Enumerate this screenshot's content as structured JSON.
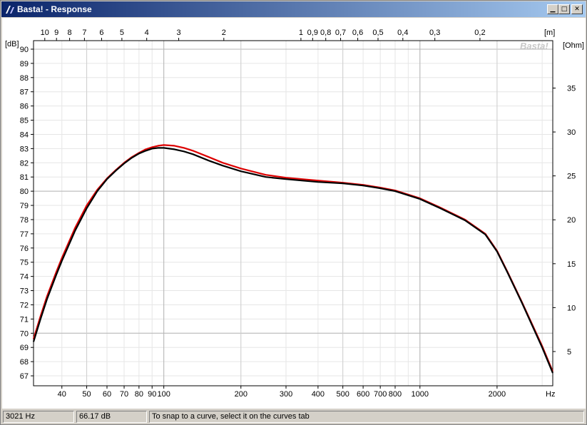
{
  "window": {
    "title": "Basta! - Response",
    "icon": "basta-app-icon"
  },
  "window_buttons": {
    "minimize": "0",
    "maximize": "1",
    "close": "r"
  },
  "watermark": "Basta!",
  "status": {
    "frequency": "3021 Hz",
    "level": "66.17 dB",
    "hint": "To snap to a curve, select it on the curves tab"
  },
  "chart_data": {
    "type": "line",
    "title": "",
    "xlabel": "Hz",
    "ylabel": "[dB]",
    "y2label": "[Ohm]",
    "x2label": "[m]",
    "xscale": "log",
    "xlim": [
      31,
      3300
    ],
    "ylim": [
      66.3,
      90.6
    ],
    "y2lim": [
      1.1,
      40.4
    ],
    "grid": true,
    "x_ticks": [
      40,
      50,
      60,
      70,
      80,
      90,
      100,
      200,
      300,
      400,
      500,
      600,
      700,
      800,
      1000,
      2000
    ],
    "x_tick_labels": [
      "40",
      "50",
      "60",
      "70",
      "80",
      "90",
      "100",
      "200",
      "300",
      "400",
      "500",
      "600",
      "700",
      "800",
      "1000",
      "2000"
    ],
    "y_ticks": [
      67,
      68,
      69,
      70,
      71,
      72,
      73,
      74,
      75,
      76,
      77,
      78,
      79,
      80,
      81,
      82,
      83,
      84,
      85,
      86,
      87,
      88,
      89,
      90
    ],
    "y2_ticks": [
      5,
      10,
      15,
      20,
      25,
      30,
      35
    ],
    "x2_ticks_m": [
      10,
      9,
      8,
      7,
      6,
      5,
      4,
      3,
      2,
      1,
      0.9,
      0.8,
      0.7,
      0.6,
      0.5,
      0.4,
      0.3,
      0.2
    ],
    "x2_tick_labels": [
      "10",
      "9",
      "8",
      "7",
      "6",
      "5",
      "4",
      "3",
      "2",
      "1",
      "0,9",
      "0,8",
      "0,7",
      "0,6",
      "0,5",
      "0,4",
      "0,3",
      "0,2"
    ],
    "series": [
      {
        "color": "#dd0000",
        "x": [
          31,
          33,
          35,
          38,
          40,
          45,
          50,
          55,
          60,
          65,
          70,
          75,
          80,
          85,
          90,
          95,
          100,
          110,
          120,
          130,
          150,
          170,
          200,
          250,
          300,
          400,
          500,
          600,
          700,
          800,
          1000,
          1200,
          1500,
          1800,
          2000,
          2200,
          2500,
          3000,
          3300
        ],
        "y": [
          69.6,
          71.2,
          72.6,
          74.3,
          75.3,
          77.4,
          79.0,
          80.1,
          80.9,
          81.5,
          82.0,
          82.4,
          82.7,
          82.95,
          83.1,
          83.2,
          83.25,
          83.2,
          83.05,
          82.85,
          82.4,
          82.0,
          81.6,
          81.15,
          80.95,
          80.75,
          80.6,
          80.45,
          80.25,
          80.05,
          79.5,
          78.85,
          78.0,
          77.0,
          75.8,
          74.3,
          72.2,
          69.1,
          67.3
        ]
      },
      {
        "color": "#000000",
        "x": [
          31,
          33,
          35,
          38,
          40,
          45,
          50,
          55,
          60,
          65,
          70,
          75,
          80,
          85,
          90,
          95,
          100,
          110,
          120,
          130,
          150,
          170,
          200,
          250,
          300,
          400,
          500,
          600,
          700,
          800,
          1000,
          1200,
          1500,
          1800,
          2000,
          2200,
          2500,
          3000,
          3300
        ],
        "y": [
          69.4,
          71.0,
          72.4,
          74.1,
          75.1,
          77.2,
          78.8,
          80.0,
          80.85,
          81.45,
          81.95,
          82.35,
          82.65,
          82.85,
          83.0,
          83.05,
          83.05,
          82.95,
          82.8,
          82.6,
          82.15,
          81.8,
          81.4,
          81.0,
          80.85,
          80.65,
          80.55,
          80.4,
          80.2,
          80.0,
          79.45,
          78.8,
          77.95,
          76.95,
          75.75,
          74.25,
          72.15,
          69.0,
          67.2
        ]
      }
    ]
  }
}
